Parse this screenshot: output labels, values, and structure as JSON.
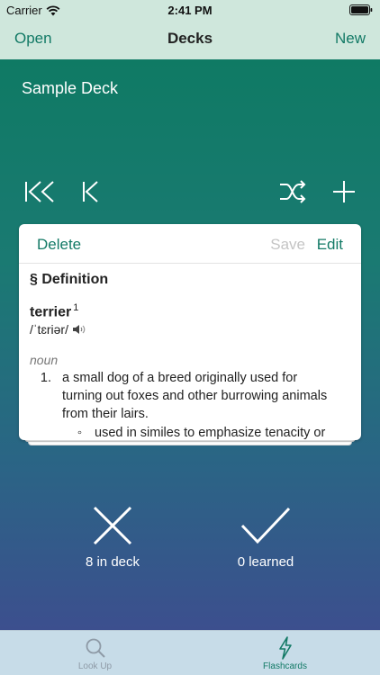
{
  "status_bar": {
    "carrier": "Carrier",
    "time": "2:41 PM"
  },
  "nav": {
    "left": "Open",
    "title": "Decks",
    "right": "New"
  },
  "deck": {
    "name": "Sample Deck"
  },
  "card": {
    "delete_label": "Delete",
    "save_label": "Save",
    "edit_label": "Edit",
    "section_heading": "§ Definition",
    "headword": "terrier",
    "homograph": "1",
    "pronunciation": "/ˈtɛriər/",
    "part_of_speech": "noun",
    "sense_number": "1.",
    "sense_text": "a small dog of a breed originally used for turning out foxes and other burrowing animals from their lairs.",
    "subsense_bullet": "◦",
    "subsense_text": "used in similes to emphasize tenacity or"
  },
  "actions": {
    "reject_label": "8 in deck",
    "accept_label": "0 learned"
  },
  "tabs": [
    {
      "label": "Look Up"
    },
    {
      "label": "Flashcards"
    }
  ],
  "colors": {
    "accent": "#137a66",
    "gradient_top": "#0f7a64",
    "gradient_bottom": "#3c4f8e",
    "tab_inactive": "#8e9aa6"
  },
  "icons": {
    "skip_to_start": "skip-to-start-icon",
    "previous": "previous-icon",
    "shuffle": "shuffle-icon",
    "add": "plus-icon",
    "reject": "x-icon",
    "accept": "checkmark-icon",
    "look_up": "magnifier-icon",
    "flashcards": "lightning-icon"
  }
}
